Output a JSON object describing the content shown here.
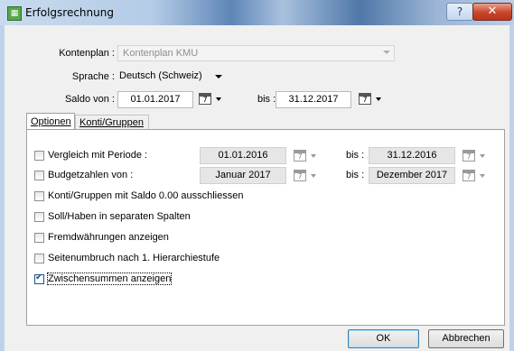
{
  "window": {
    "title": "Erfolgsrechnung",
    "help": "?",
    "close": "✕"
  },
  "kontenplan": {
    "label": "Kontenplan :",
    "value": "Kontenplan KMU"
  },
  "sprache": {
    "label": "Sprache :",
    "value": "Deutsch (Schweiz)"
  },
  "saldo": {
    "label": "Saldo von :",
    "from": "01.01.2017",
    "bis_label": "bis :",
    "to": "31.12.2017",
    "cal_day": "7"
  },
  "tabs": [
    {
      "label": "Optionen"
    },
    {
      "label": "Konti/Gruppen"
    }
  ],
  "options": {
    "vergleich": {
      "label": "Vergleich mit Periode :",
      "from": "01.01.2016",
      "bis_label": "bis :",
      "to": "31.12.2016",
      "checked": false
    },
    "budget": {
      "label": "Budgetzahlen von :",
      "from": "Januar 2017",
      "bis_label": "bis :",
      "to": "Dezember 2017",
      "checked": false
    },
    "saldo_null": {
      "label": "Konti/Gruppen mit Saldo 0.00 ausschliessen",
      "checked": false
    },
    "soll_haben": {
      "label": "Soll/Haben in separaten Spalten",
      "checked": false
    },
    "fremdwaehrung": {
      "label": "Fremdwährungen anzeigen",
      "checked": false
    },
    "seitenumbruch": {
      "label": "Seitenumbruch nach 1. Hierarchiestufe",
      "checked": false
    },
    "zwischensummen": {
      "label": "Zwischensummen anzeigen",
      "checked": true
    }
  },
  "buttons": {
    "ok": "OK",
    "cancel": "Abbrechen"
  },
  "colors": {
    "title_bar": "#b3cbe6",
    "close_button": "#c8452c",
    "dialog_bg": "#f0f0f0",
    "check_mark": "#1f4f8f"
  }
}
